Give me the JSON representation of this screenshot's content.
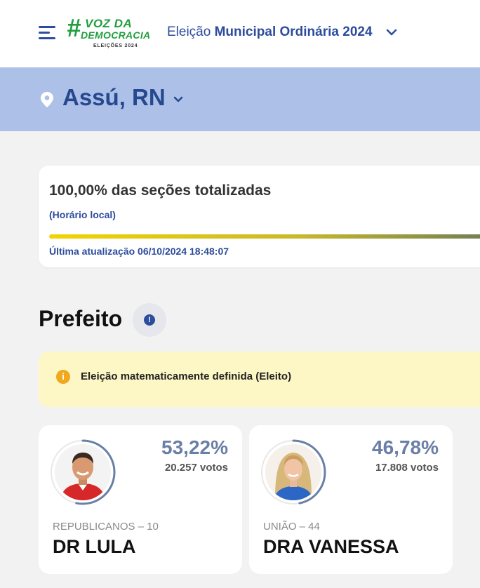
{
  "header": {
    "logo": {
      "hash": "#",
      "line1": "VOZ DA",
      "line2": "DEMOCRACIA",
      "line3": "ELEIÇÕES 2024"
    },
    "election_prefix": "Eleição",
    "election_name": "Municipal Ordinária 2024"
  },
  "location": {
    "city": "Assú, RN"
  },
  "progress": {
    "title": "100,00% das seções totalizadas",
    "percent": 100,
    "local_time_label": "(Horário local)",
    "last_update": "Última atualização 06/10/2024 18:48:07"
  },
  "section": {
    "title": "Prefeito"
  },
  "alert": {
    "text": "Eleição matematicamente definida (Eleito)"
  },
  "candidates": [
    {
      "percent": "53,22%",
      "share": 0.5322,
      "votes": "20.257 votos",
      "party": "REPUBLICANOS – 10",
      "name": "DR LULA"
    },
    {
      "percent": "46,78%",
      "share": 0.4678,
      "votes": "17.808 votos",
      "party": "UNIÃO – 44",
      "name": "DRA VANESSA"
    }
  ],
  "colors": {
    "brand_blue": "#2c4c9c",
    "band_blue": "#adc1e8",
    "logo_green": "#1f9e3d",
    "alert_bg": "#fdf7c6",
    "alert_icon": "#f1a81c",
    "percent_text": "#6a7fa6"
  },
  "icons": {
    "menu": "hamburger-icon",
    "election_dropdown": "chevron-down-icon",
    "location": "location-pin-icon",
    "city_dropdown": "chevron-down-icon",
    "section_info": "info-icon",
    "alert": "info-circle-icon"
  }
}
